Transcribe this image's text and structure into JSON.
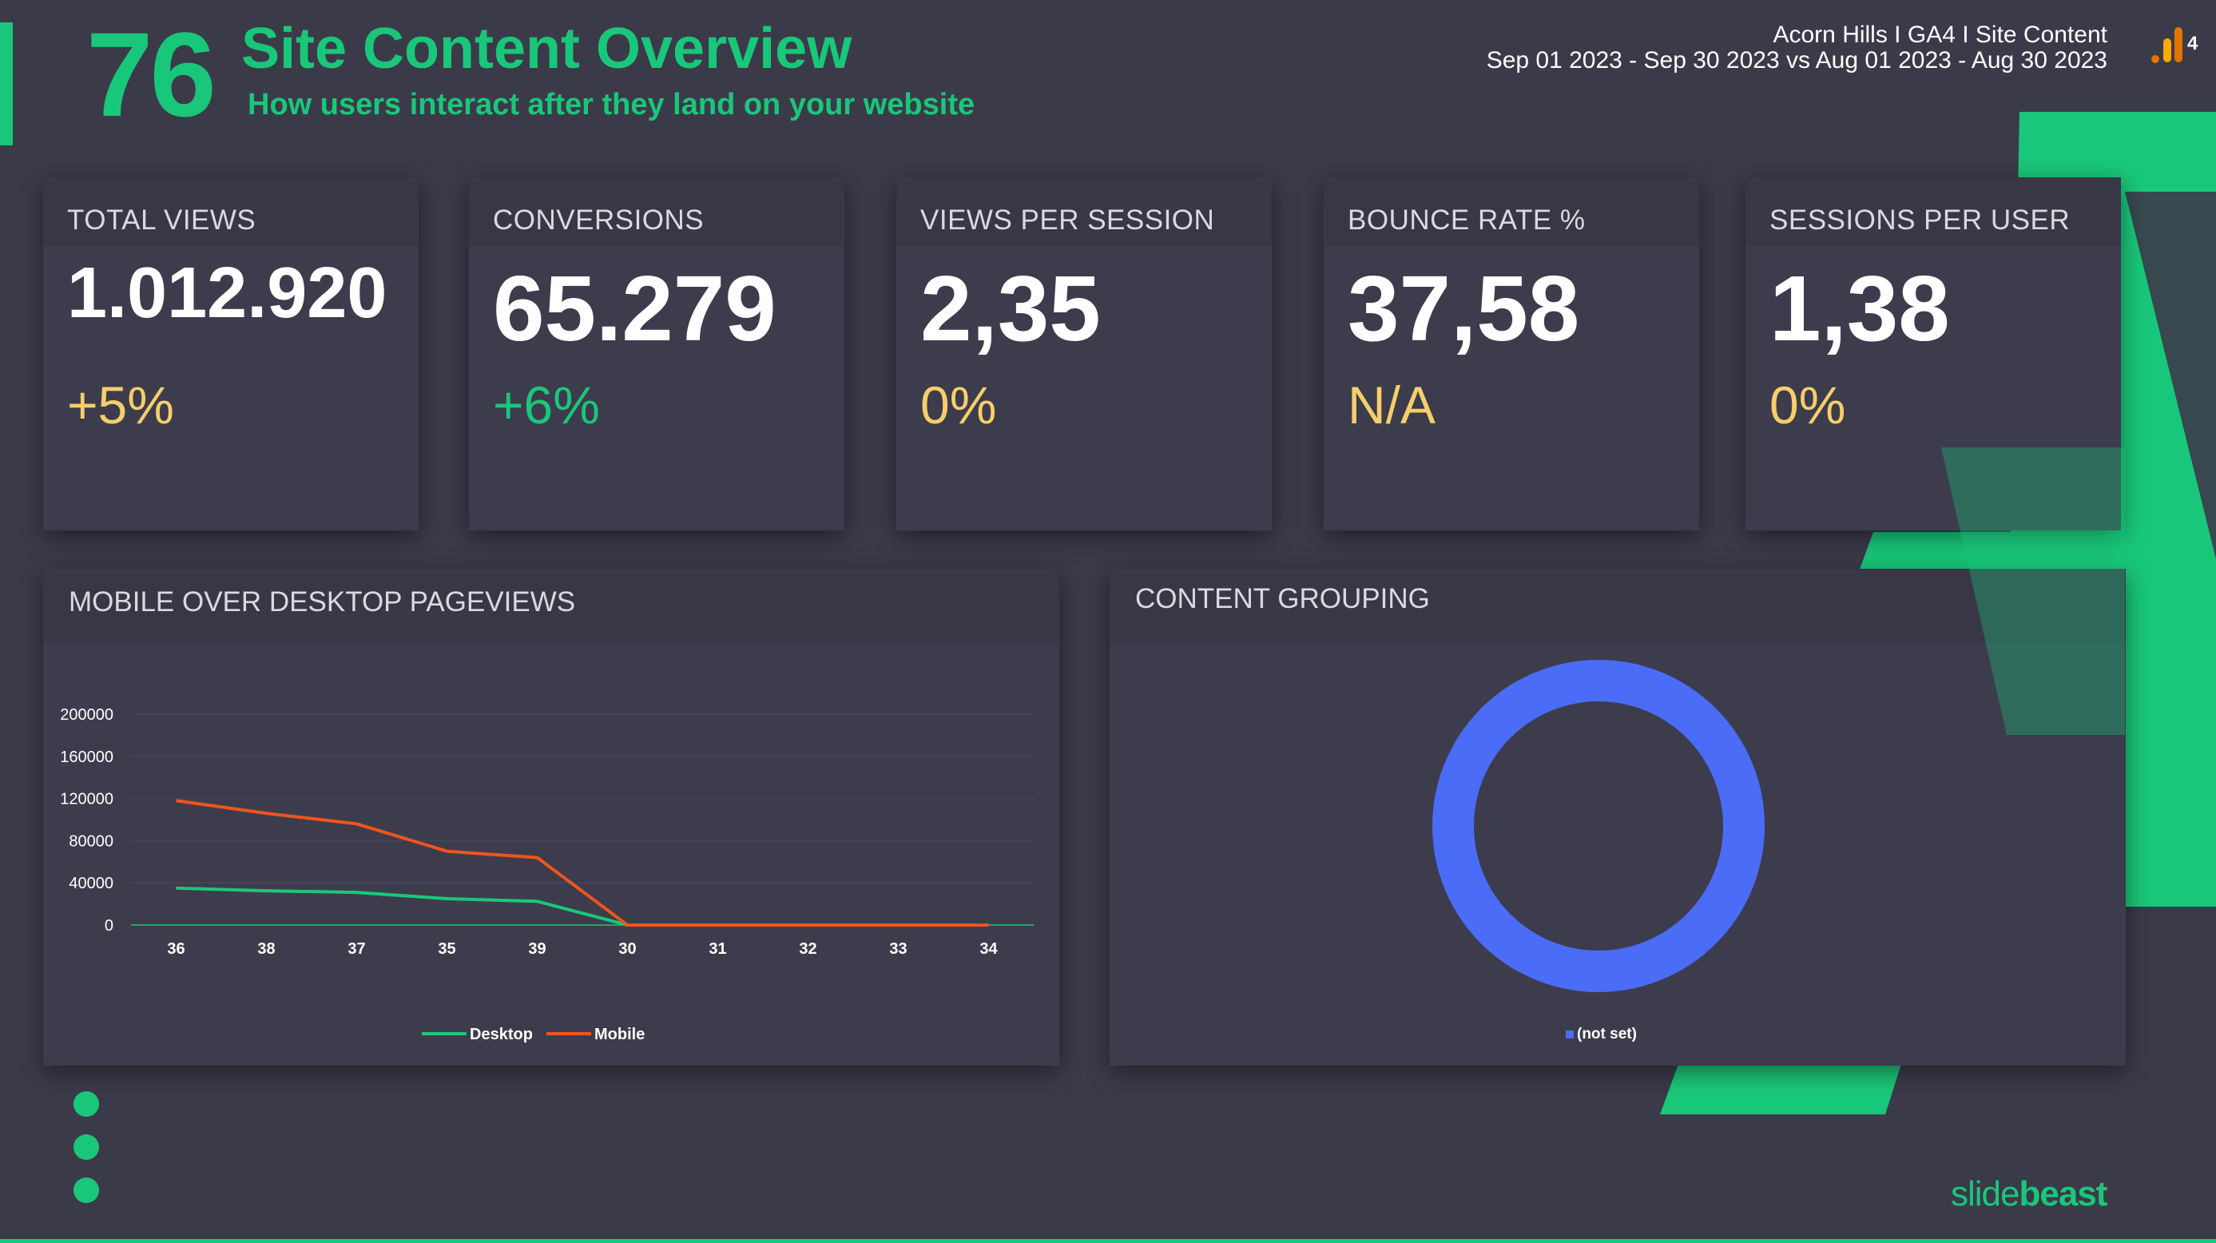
{
  "header": {
    "slide_number": "76",
    "title": "Site Content Overview",
    "subtitle": "How users interact after they land on your website",
    "report_name": "Acorn Hills I GA4 I Site Content",
    "date_range": "Sep 01 2023 - Sep 30 2023 vs Aug 01 2023 - Aug 30 2023",
    "ga_badge": "4"
  },
  "colors": {
    "accent": "#19c77a",
    "positive": "#19c77a",
    "neutral": "#f6cf6b",
    "mobile": "#f0541e",
    "desktop": "#19c77a",
    "donut": "#4a6cf7"
  },
  "kpis": [
    {
      "label": "TOTAL VIEWS",
      "value": "1.012.920",
      "delta": "+5%",
      "delta_color": "#f6cf6b"
    },
    {
      "label": "CONVERSIONS",
      "value": "65.279",
      "delta": "+6%",
      "delta_color": "#19c77a"
    },
    {
      "label": "VIEWS PER SESSION",
      "value": "2,35",
      "delta": "0%",
      "delta_color": "#f6cf6b"
    },
    {
      "label": "BOUNCE RATE %",
      "value": "37,58",
      "delta": "N/A",
      "delta_color": "#f6cf6b"
    },
    {
      "label": "SESSIONS PER USER",
      "value": "1,38",
      "delta": "0%",
      "delta_color": "#f6cf6b"
    }
  ],
  "panels": {
    "line_title": "MOBILE OVER DESKTOP PAGEVIEWS",
    "donut_title": "CONTENT GROUPING"
  },
  "chart_data": [
    {
      "type": "line",
      "title": "MOBILE OVER DESKTOP PAGEVIEWS",
      "categories": [
        "36",
        "38",
        "37",
        "35",
        "39",
        "30",
        "31",
        "32",
        "33",
        "34"
      ],
      "ylim": [
        0,
        200000
      ],
      "yticks": [
        "200000",
        "160000",
        "120000",
        "80000",
        "40000",
        "0"
      ],
      "series": [
        {
          "name": "Desktop",
          "color": "#19c77a",
          "values": [
            35000,
            32500,
            31000,
            25000,
            22500,
            0,
            0,
            0,
            0,
            0
          ]
        },
        {
          "name": "Mobile",
          "color": "#f0541e",
          "values": [
            118000,
            106000,
            96000,
            70000,
            64000,
            0,
            0,
            0,
            0,
            0
          ]
        }
      ],
      "legend": "bottom"
    },
    {
      "type": "pie",
      "title": "CONTENT GROUPING",
      "labels": [
        "(not set)"
      ],
      "values": [
        100
      ],
      "colors": [
        "#4a6cf7"
      ],
      "legend": "bottom"
    }
  ],
  "branding": {
    "logo_light": "slide",
    "logo_bold": "beast"
  }
}
